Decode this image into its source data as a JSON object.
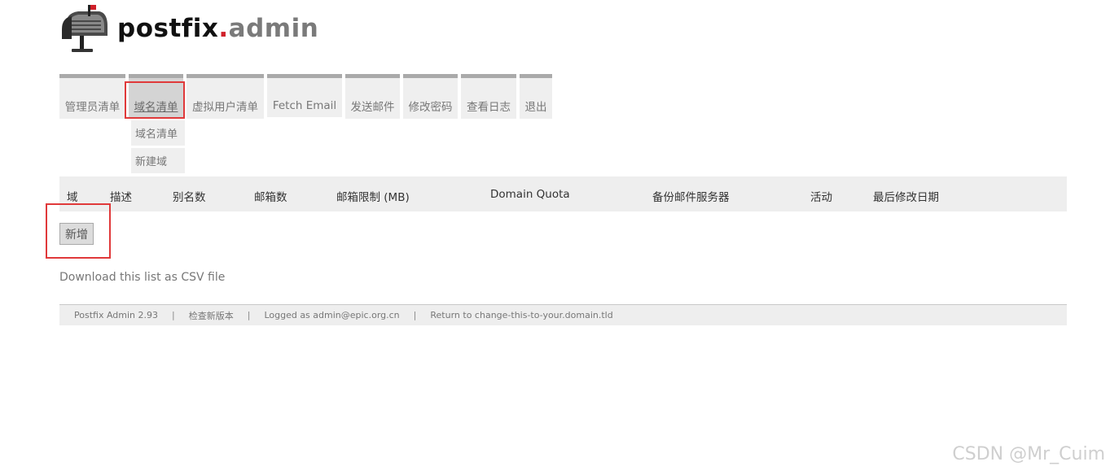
{
  "logo": {
    "text_main": "postfix",
    "text_dot": ".",
    "text_suffix": "admin"
  },
  "menu": {
    "items": [
      {
        "label": "管理员清单"
      },
      {
        "label": "域名清单"
      },
      {
        "label": "虚拟用户清单"
      },
      {
        "label": "Fetch Email"
      },
      {
        "label": "发送邮件"
      },
      {
        "label": "修改密码"
      },
      {
        "label": "查看日志"
      },
      {
        "label": "退出"
      }
    ],
    "submenu": [
      {
        "label": "域名清单"
      },
      {
        "label": "新建域"
      }
    ]
  },
  "table": {
    "headers": [
      "域",
      "描述",
      "别名数",
      "邮箱数",
      "邮箱限制 (MB)",
      "Domain Quota",
      "备份邮件服务器",
      "活动",
      "最后修改日期"
    ]
  },
  "actions": {
    "add_label": "新增",
    "csv_label": "Download this list as CSV file"
  },
  "footer": {
    "version": "Postfix Admin 2.93",
    "check_update": "检查新版本",
    "logged_as": "Logged as admin@epic.org.cn",
    "return_to": "Return to change-this-to-your.domain.tld",
    "separator": "|"
  },
  "watermark": "CSDN @Mr_Cuim",
  "colors": {
    "highlight": "#e0393a",
    "menu_border": "#aaaaaa",
    "brand_red": "#d0202a"
  }
}
